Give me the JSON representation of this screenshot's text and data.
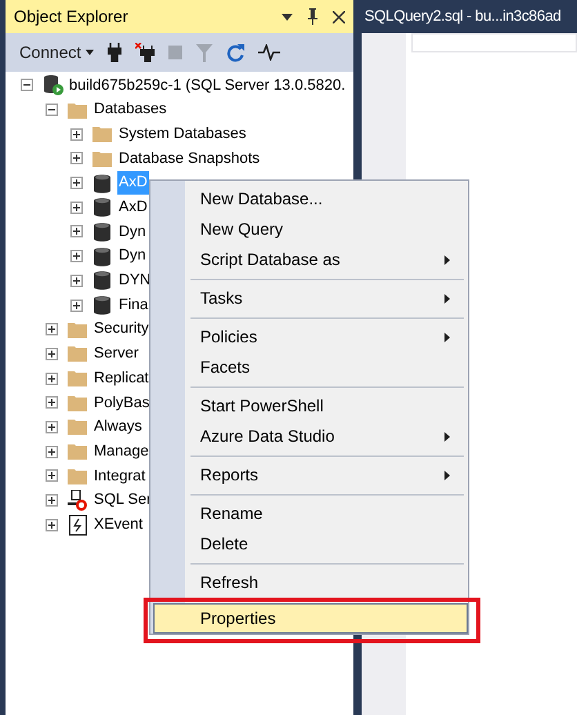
{
  "object_explorer": {
    "title": "Object Explorer",
    "toolbar": {
      "connect_label": "Connect"
    }
  },
  "tree": [
    {
      "label": "build675b259c-1 (SQL Server 13.0.5820.",
      "kind": "server",
      "expanded": true,
      "selected": false,
      "children": [
        {
          "label": "Databases",
          "kind": "folder",
          "expanded": true,
          "selected": false,
          "children": [
            {
              "label": "System Databases",
              "kind": "folder",
              "expanded": false,
              "selected": false
            },
            {
              "label": "Database Snapshots",
              "kind": "folder",
              "expanded": false,
              "selected": false
            },
            {
              "label": "AxD",
              "kind": "database",
              "expanded": false,
              "selected": true
            },
            {
              "label": "AxD",
              "kind": "database",
              "expanded": false,
              "selected": false
            },
            {
              "label": "Dyn",
              "kind": "database",
              "expanded": false,
              "selected": false
            },
            {
              "label": "Dyn",
              "kind": "database",
              "expanded": false,
              "selected": false
            },
            {
              "label": "DYN",
              "kind": "database",
              "expanded": false,
              "selected": false
            },
            {
              "label": "Fina",
              "kind": "database",
              "expanded": false,
              "selected": false
            }
          ]
        },
        {
          "label": "Security",
          "kind": "folder",
          "expanded": false,
          "selected": false
        },
        {
          "label": "Server",
          "kind": "folder",
          "expanded": false,
          "selected": false
        },
        {
          "label": "Replicat",
          "kind": "folder",
          "expanded": false,
          "selected": false
        },
        {
          "label": "PolyBas",
          "kind": "folder",
          "expanded": false,
          "selected": false
        },
        {
          "label": "Always",
          "kind": "folder",
          "expanded": false,
          "selected": false
        },
        {
          "label": "Manage",
          "kind": "folder",
          "expanded": false,
          "selected": false
        },
        {
          "label": "Integrat",
          "kind": "folder",
          "expanded": false,
          "selected": false
        },
        {
          "label": "SQL Ser",
          "kind": "agent",
          "expanded": false,
          "selected": false
        },
        {
          "label": "XEvent",
          "kind": "xevent",
          "expanded": false,
          "selected": false
        }
      ]
    }
  ],
  "editor_tab": {
    "title": "SQLQuery2.sql - bu...in3c86ad"
  },
  "context_menu": {
    "items": [
      {
        "kind": "item",
        "label": "New Database...",
        "submenu": false,
        "selected": false
      },
      {
        "kind": "item",
        "label": "New Query",
        "submenu": false,
        "selected": false
      },
      {
        "kind": "item",
        "label": "Script Database as",
        "submenu": true,
        "selected": false
      },
      {
        "kind": "separator"
      },
      {
        "kind": "item",
        "label": "Tasks",
        "submenu": true,
        "selected": false
      },
      {
        "kind": "separator"
      },
      {
        "kind": "item",
        "label": "Policies",
        "submenu": true,
        "selected": false
      },
      {
        "kind": "item",
        "label": "Facets",
        "submenu": false,
        "selected": false
      },
      {
        "kind": "separator"
      },
      {
        "kind": "item",
        "label": "Start PowerShell",
        "submenu": false,
        "selected": false
      },
      {
        "kind": "item",
        "label": "Azure Data Studio",
        "submenu": true,
        "selected": false
      },
      {
        "kind": "separator"
      },
      {
        "kind": "item",
        "label": "Reports",
        "submenu": true,
        "selected": false
      },
      {
        "kind": "separator"
      },
      {
        "kind": "item",
        "label": "Rename",
        "submenu": false,
        "selected": false
      },
      {
        "kind": "item",
        "label": "Delete",
        "submenu": false,
        "selected": false
      },
      {
        "kind": "separator"
      },
      {
        "kind": "item",
        "label": "Refresh",
        "submenu": false,
        "selected": false
      },
      {
        "kind": "item",
        "label": "Properties",
        "submenu": false,
        "selected": true
      }
    ]
  }
}
